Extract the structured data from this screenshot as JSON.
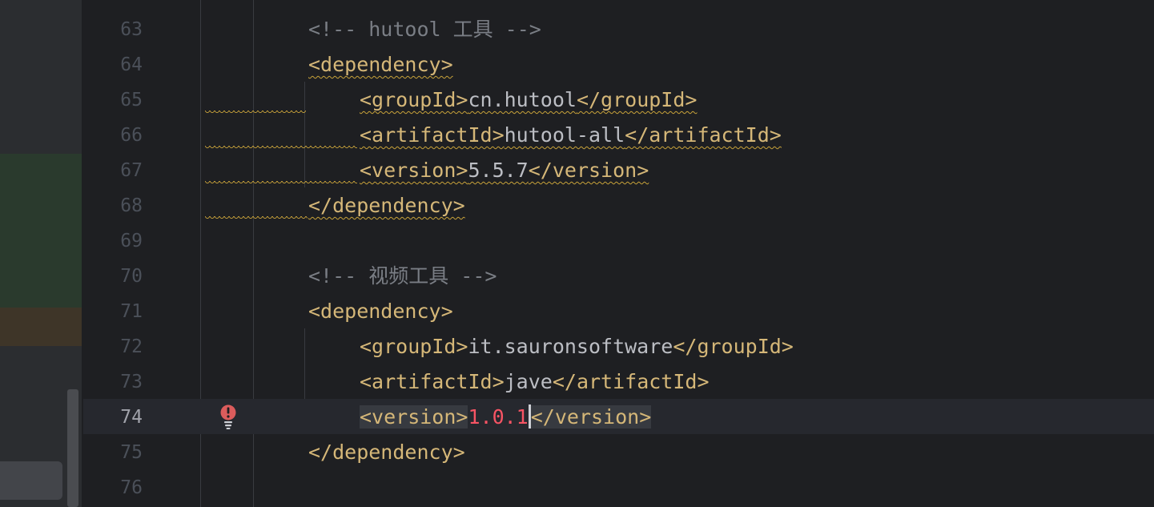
{
  "gutter": {
    "line_numbers": [
      "63",
      "64",
      "65",
      "66",
      "67",
      "68",
      "69",
      "70",
      "71",
      "72",
      "73",
      "74",
      "75",
      "76"
    ],
    "current_line": "74"
  },
  "code": {
    "l63": {
      "comment": "<!-- hutool 工具 -->"
    },
    "l64": {
      "open": "<dependency>"
    },
    "l65": {
      "open": "<groupId>",
      "text": "cn.hutool",
      "close": "</groupId>"
    },
    "l66": {
      "open": "<artifactId>",
      "text": "hutool-all",
      "close": "</artifactId>"
    },
    "l67": {
      "open": "<version>",
      "text": "5.5.7",
      "close": "</version>"
    },
    "l68": {
      "close": "</dependency>"
    },
    "l70": {
      "comment": "<!-- 视频工具 -->"
    },
    "l71": {
      "open": "<dependency>"
    },
    "l72": {
      "open": "<groupId>",
      "text": "it.sauronsoftware",
      "close": "</groupId>"
    },
    "l73": {
      "open": "<artifactId>",
      "text": "jave",
      "close": "</artifactId>"
    },
    "l74": {
      "open": "<version>",
      "text": "1.0.1",
      "close": "</version>"
    },
    "l75": {
      "close": "</dependency>"
    }
  },
  "icons": {
    "intention": "error-intention-bulb-icon"
  },
  "colors": {
    "background": "#1e1f22",
    "tag": "#d5b778",
    "comment": "#7a7e85",
    "error": "#f75464",
    "warning_underline": "#c9a33a"
  }
}
